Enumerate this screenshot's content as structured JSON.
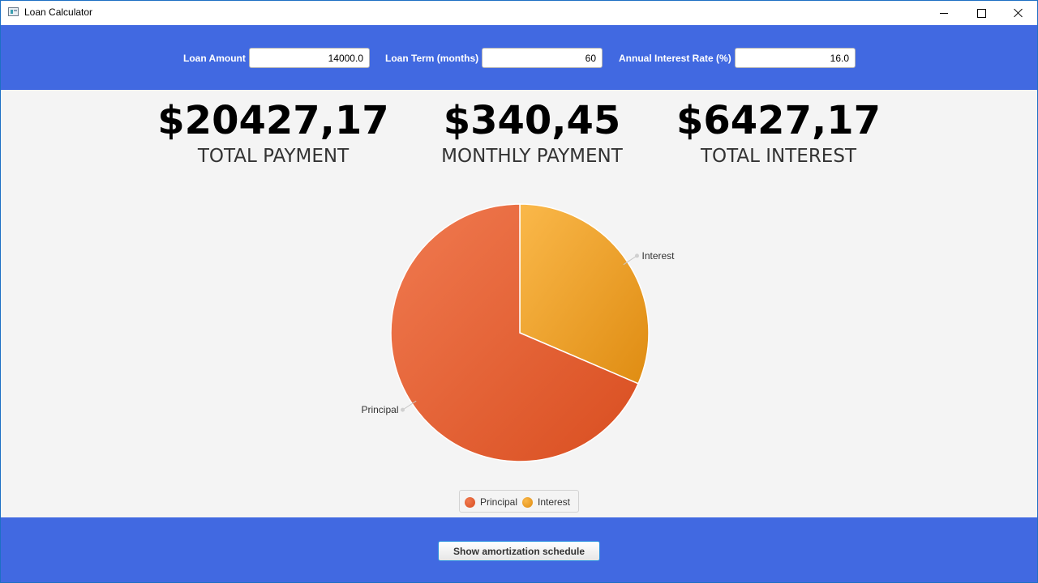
{
  "window": {
    "title": "Loan Calculator",
    "controls": {
      "minimize": "minimize-icon",
      "maximize": "maximize-icon",
      "close": "close-icon"
    }
  },
  "form": {
    "loan_amount": {
      "label": "Loan Amount",
      "value": "14000.0"
    },
    "loan_term": {
      "label": "Loan Term (months)",
      "value": "60"
    },
    "interest_rate": {
      "label": "Annual Interest Rate (%)",
      "value": "16.0"
    }
  },
  "summary": {
    "total_payment": {
      "value": "$20427,17",
      "label": "TOTAL PAYMENT"
    },
    "monthly_payment": {
      "value": "$340,45",
      "label": "MONTHLY PAYMENT"
    },
    "total_interest": {
      "value": "$6427,17",
      "label": "TOTAL INTEREST"
    }
  },
  "chart_data": {
    "type": "pie",
    "slices": [
      {
        "label": "Principal",
        "value": 14000.0,
        "color": "#e45c2f"
      },
      {
        "label": "Interest",
        "value": 6427.17,
        "color": "#f0a030"
      }
    ],
    "legend": [
      "Principal",
      "Interest"
    ],
    "legend_position": "bottom"
  },
  "actions": {
    "amortization_button": "Show amortization schedule"
  },
  "colors": {
    "header_bg": "#4169e1",
    "content_bg": "#f4f4f4",
    "principal": "#e45c2f",
    "interest": "#f0a030"
  }
}
